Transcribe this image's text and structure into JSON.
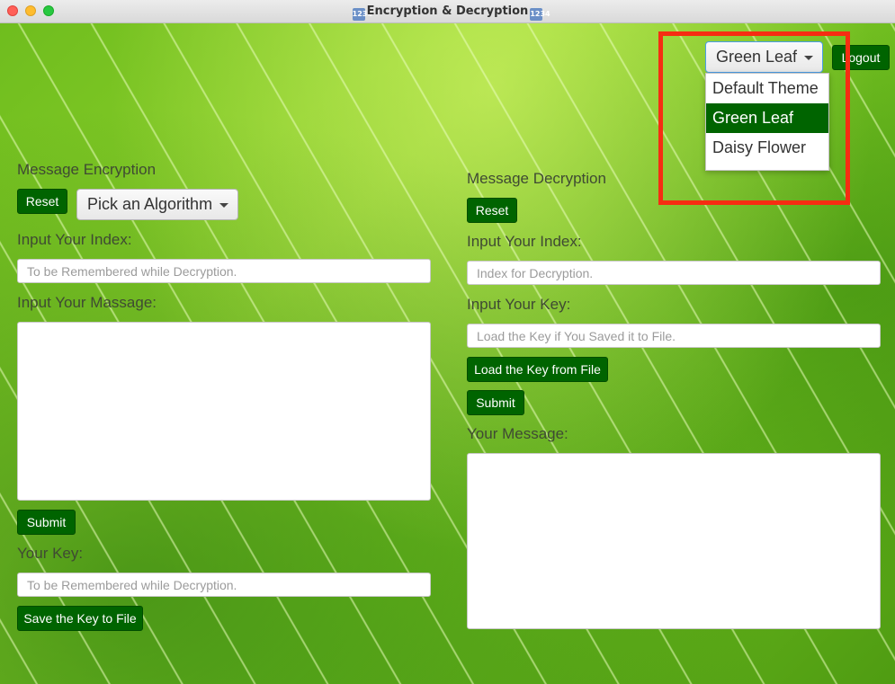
{
  "window": {
    "title": "Encryption & Decryption",
    "title_icon_glyph": "1234"
  },
  "theme_selector": {
    "value": "Green Leaf",
    "options": [
      "Default Theme",
      "Green Leaf",
      "Daisy Flower"
    ],
    "selected_index": 1
  },
  "logout_label": "Logout",
  "encryption": {
    "heading": "Message Encryption",
    "reset_label": "Reset",
    "algorithm_placeholder": "Pick an Algorithm",
    "index_label": "Input Your Index:",
    "index_placeholder": "To be Remembered while Decryption.",
    "message_label": "Input Your Massage:",
    "submit_label": "Submit",
    "key_label": "Your Key:",
    "key_placeholder": "To be Remembered while Decryption.",
    "save_key_label": "Save the Key to File"
  },
  "decryption": {
    "heading": "Message Decryption",
    "reset_label": "Reset",
    "index_label": "Input Your Index:",
    "index_placeholder": "Index for Decryption.",
    "key_label": "Input Your Key:",
    "key_placeholder": "Load the Key if You Saved it to File.",
    "load_key_label": "Load the Key from File",
    "submit_label": "Submit",
    "message_label": "Your Message:"
  },
  "colors": {
    "button_green": "#006400",
    "highlight_red": "#f62d12"
  }
}
